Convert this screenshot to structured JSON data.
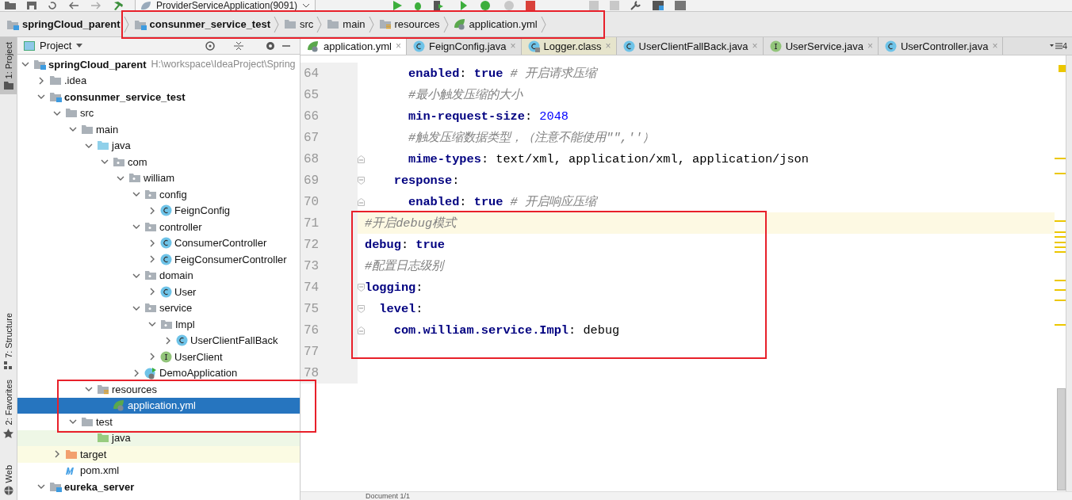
{
  "toolbar": {
    "run_config": "ProviderServiceApplication(9091)"
  },
  "breadcrumbs": [
    {
      "label": "springCloud_parent",
      "kind": "module"
    },
    {
      "label": "consunmer_service_test",
      "kind": "module"
    },
    {
      "label": "src",
      "kind": "folder"
    },
    {
      "label": "main",
      "kind": "folder"
    },
    {
      "label": "resources",
      "kind": "resources"
    },
    {
      "label": "application.yml",
      "kind": "yaml"
    }
  ],
  "tool_strip": [
    {
      "label": "1: Project",
      "selected": true
    },
    {
      "label": "7: Structure",
      "selected": false
    },
    {
      "label": "2: Favorites",
      "selected": false
    },
    {
      "label": "Web",
      "selected": false
    }
  ],
  "project_panel": {
    "title": "Project",
    "tree": [
      {
        "label": "springCloud_parent",
        "kind": "module",
        "hint": "H:\\workspace\\IdeaProject\\Spring",
        "expanded": true,
        "selected": false,
        "children": [
          {
            "label": ".idea",
            "kind": "folder",
            "expanded": false,
            "selected": false
          },
          {
            "label": "consunmer_service_test",
            "kind": "module",
            "expanded": true,
            "selected": false,
            "children": [
              {
                "label": "src",
                "kind": "folder",
                "expanded": true,
                "selected": false,
                "children": [
                  {
                    "label": "main",
                    "kind": "folder",
                    "expanded": true,
                    "selected": false,
                    "children": [
                      {
                        "label": "java",
                        "kind": "source",
                        "expanded": true,
                        "selected": false,
                        "children": [
                          {
                            "label": "com",
                            "kind": "package",
                            "expanded": true,
                            "selected": false,
                            "children": [
                              {
                                "label": "william",
                                "kind": "package",
                                "expanded": true,
                                "selected": false,
                                "children": [
                                  {
                                    "label": "config",
                                    "kind": "package",
                                    "expanded": true,
                                    "selected": false,
                                    "children": [
                                      {
                                        "label": "FeignConfig",
                                        "kind": "class",
                                        "expanded": false,
                                        "selected": false
                                      }
                                    ]
                                  },
                                  {
                                    "label": "controller",
                                    "kind": "package",
                                    "expanded": true,
                                    "selected": false,
                                    "children": [
                                      {
                                        "label": "ConsumerController",
                                        "kind": "class",
                                        "expanded": false,
                                        "selected": false
                                      },
                                      {
                                        "label": "FeigConsumerController",
                                        "kind": "class",
                                        "expanded": false,
                                        "selected": false
                                      }
                                    ]
                                  },
                                  {
                                    "label": "domain",
                                    "kind": "package",
                                    "expanded": true,
                                    "selected": false,
                                    "children": [
                                      {
                                        "label": "User",
                                        "kind": "class",
                                        "expanded": false,
                                        "selected": false
                                      }
                                    ]
                                  },
                                  {
                                    "label": "service",
                                    "kind": "package",
                                    "expanded": true,
                                    "selected": false,
                                    "children": [
                                      {
                                        "label": "Impl",
                                        "kind": "package",
                                        "expanded": true,
                                        "selected": false,
                                        "children": [
                                          {
                                            "label": "UserClientFallBack",
                                            "kind": "class",
                                            "expanded": false,
                                            "selected": false
                                          }
                                        ]
                                      },
                                      {
                                        "label": "UserClient",
                                        "kind": "interface",
                                        "expanded": false,
                                        "selected": false
                                      }
                                    ]
                                  },
                                  {
                                    "label": "DemoApplication",
                                    "kind": "spring",
                                    "expanded": false,
                                    "selected": false
                                  }
                                ]
                              }
                            ]
                          }
                        ]
                      },
                      {
                        "label": "resources",
                        "kind": "resources",
                        "expanded": true,
                        "selected": false,
                        "children": [
                          {
                            "label": "application.yml",
                            "kind": "yaml",
                            "selected": true
                          }
                        ]
                      }
                    ]
                  },
                  {
                    "label": "test",
                    "kind": "folder",
                    "expanded": true,
                    "selected": false,
                    "children": [
                      {
                        "label": "java",
                        "kind": "testsource",
                        "selected": false
                      }
                    ]
                  }
                ]
              },
              {
                "label": "target",
                "kind": "excluded",
                "expanded": false,
                "selected": false
              },
              {
                "label": "pom.xml",
                "kind": "maven",
                "selected": false
              }
            ]
          },
          {
            "label": "eureka_server",
            "kind": "module",
            "expanded": true,
            "selected": false
          }
        ]
      }
    ]
  },
  "tabs": [
    {
      "label": "application.yml",
      "kind": "yaml",
      "selected": true,
      "close": "×"
    },
    {
      "label": "FeignConfig.java",
      "kind": "class",
      "selected": false,
      "close": "×"
    },
    {
      "label": "Logger.class",
      "kind": "library",
      "selected": false,
      "close": "×"
    },
    {
      "label": "UserClientFallBack.java",
      "kind": "class",
      "selected": false,
      "close": "×"
    },
    {
      "label": "UserService.java",
      "kind": "interface",
      "selected": false,
      "close": "×"
    },
    {
      "label": "UserController.java",
      "kind": "class",
      "selected": false,
      "close": "×"
    }
  ],
  "tab_overflow": "4",
  "editor": {
    "lines": [
      {
        "number": "64",
        "current": false,
        "tokens": [
          {
            "kind": "key",
            "text": "      enabled"
          },
          {
            "kind": "plain",
            "text": ": "
          },
          {
            "kind": "value",
            "text": "true"
          },
          {
            "kind": "comment",
            "text": " # 开启请求压缩"
          }
        ]
      },
      {
        "number": "65",
        "current": false,
        "tokens": [
          {
            "kind": "comment",
            "text": "      #最小触发压缩的大小"
          }
        ]
      },
      {
        "number": "66",
        "current": false,
        "tokens": [
          {
            "kind": "key",
            "text": "      min-request-size"
          },
          {
            "kind": "plain",
            "text": ": "
          },
          {
            "kind": "number",
            "text": "2048"
          }
        ]
      },
      {
        "number": "67",
        "current": false,
        "tokens": [
          {
            "kind": "comment",
            "text": "      #触发压缩数据类型，（注意不能使用\"\",''）"
          }
        ]
      },
      {
        "number": "68",
        "current": false,
        "fold": {
          "kind": "end"
        },
        "tokens": [
          {
            "kind": "key",
            "text": "      mime-types"
          },
          {
            "kind": "plain",
            "text": ": text/xml, application/xml, application/json"
          }
        ]
      },
      {
        "number": "69",
        "current": false,
        "fold": {
          "kind": "start"
        },
        "tokens": [
          {
            "kind": "key",
            "text": "    response"
          },
          {
            "kind": "plain",
            "text": ":"
          }
        ]
      },
      {
        "number": "70",
        "current": false,
        "fold": {
          "kind": "end"
        },
        "tokens": [
          {
            "kind": "key",
            "text": "      enabled"
          },
          {
            "kind": "plain",
            "text": ": "
          },
          {
            "kind": "value",
            "text": "true"
          },
          {
            "kind": "comment",
            "text": " # 开启响应压缩"
          }
        ]
      },
      {
        "number": "71",
        "current": true,
        "tokens": [
          {
            "kind": "comment",
            "text": "#开启debug模式"
          }
        ]
      },
      {
        "number": "72",
        "current": false,
        "tokens": [
          {
            "kind": "key",
            "text": "debug"
          },
          {
            "kind": "plain",
            "text": ": "
          },
          {
            "kind": "value",
            "text": "true"
          }
        ]
      },
      {
        "number": "73",
        "current": false,
        "tokens": [
          {
            "kind": "comment",
            "text": "#配置日志级别"
          }
        ]
      },
      {
        "number": "74",
        "current": false,
        "fold": {
          "kind": "start"
        },
        "tokens": [
          {
            "kind": "key",
            "text": "logging"
          },
          {
            "kind": "plain",
            "text": ":"
          }
        ]
      },
      {
        "number": "75",
        "current": false,
        "fold": {
          "kind": "start"
        },
        "tokens": [
          {
            "kind": "key",
            "text": "  level"
          },
          {
            "kind": "plain",
            "text": ":"
          }
        ]
      },
      {
        "number": "76",
        "current": false,
        "fold": {
          "kind": "end"
        },
        "tokens": [
          {
            "kind": "key",
            "text": "    com.william.service.Impl"
          },
          {
            "kind": "plain",
            "text": ": debug"
          }
        ]
      },
      {
        "number": "77",
        "current": false
      },
      {
        "number": "78",
        "current": false
      }
    ],
    "status": "Document 1/1"
  }
}
